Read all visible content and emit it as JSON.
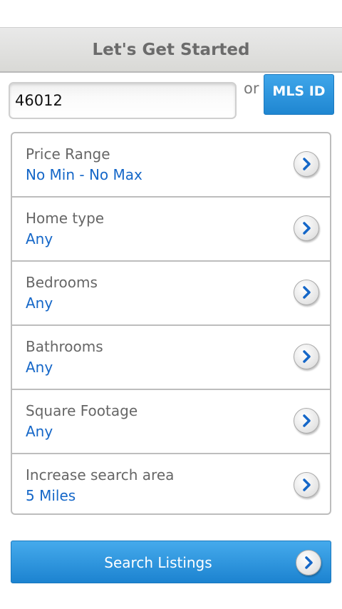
{
  "header": {
    "title": "Let's Get Started"
  },
  "search_form": {
    "zip_value": "46012",
    "or_label": "or",
    "mls_button_label": "MLS ID"
  },
  "filters": [
    {
      "label": "Price Range",
      "value": "No Min - No Max"
    },
    {
      "label": "Home type",
      "value": "Any"
    },
    {
      "label": "Bedrooms",
      "value": "Any"
    },
    {
      "label": "Bathrooms",
      "value": "Any"
    },
    {
      "label": "Square Footage",
      "value": "Any"
    },
    {
      "label": "Increase search area",
      "value": "5 Miles"
    }
  ],
  "search_button": {
    "label": "Search Listings"
  },
  "icons": {
    "row_chevron": "chevron-right-icon"
  },
  "colors": {
    "accent": "#1f86d1",
    "value_text": "#1567c8"
  }
}
